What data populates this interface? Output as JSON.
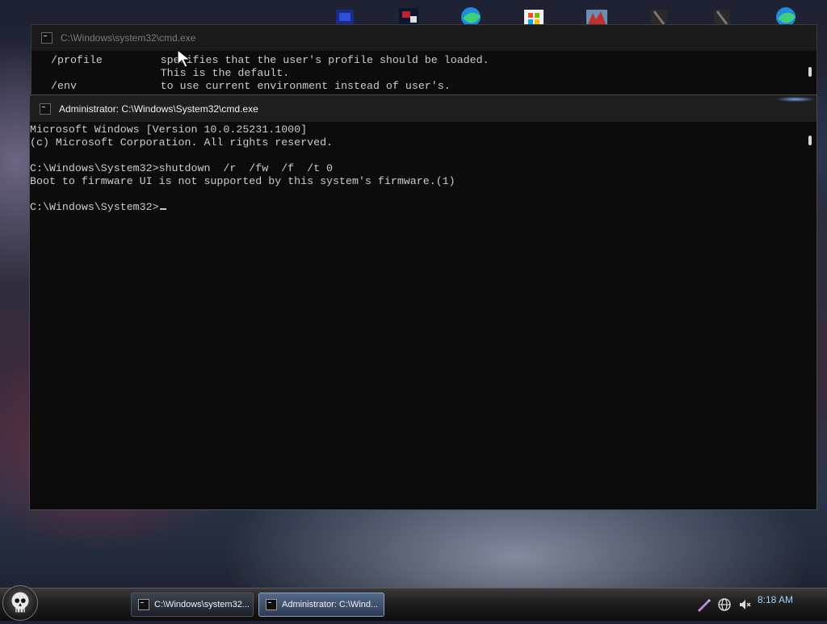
{
  "desktop": {
    "top_icons": [
      "app-icon",
      "app-icon",
      "edge-icon",
      "store-icon",
      "app-icon",
      "app-icon",
      "app-icon",
      "edge-icon"
    ]
  },
  "back_window": {
    "title": "C:\\Windows\\system32\\cmd.exe",
    "console_lines": [
      "/profile         specifies that the user's profile should be loaded.",
      "                 This is the default.",
      "/env             to use current environment instead of user's."
    ]
  },
  "front_window": {
    "title": "Administrator: C:\\Windows\\System32\\cmd.exe",
    "console_lines": [
      "Microsoft Windows [Version 10.0.25231.1000]",
      "(c) Microsoft Corporation. All rights reserved.",
      "",
      "C:\\Windows\\System32>shutdown  /r  /fw  /f  /t 0",
      "Boot to firmware UI is not supported by this system's firmware.(1)",
      ""
    ],
    "prompt": "C:\\Windows\\System32>"
  },
  "taskbar": {
    "buttons": [
      {
        "label": "C:\\Windows\\system32..."
      },
      {
        "label": "Administrator: C:\\Wind..."
      }
    ],
    "tray_icons": [
      "pen-icon",
      "globe-icon",
      "volume-muted-icon"
    ],
    "clock": "8:18 AM"
  },
  "colors": {
    "console_bg": "#0c0c0c",
    "console_text": "#cccccc",
    "clock_text": "#9fd0ff"
  }
}
